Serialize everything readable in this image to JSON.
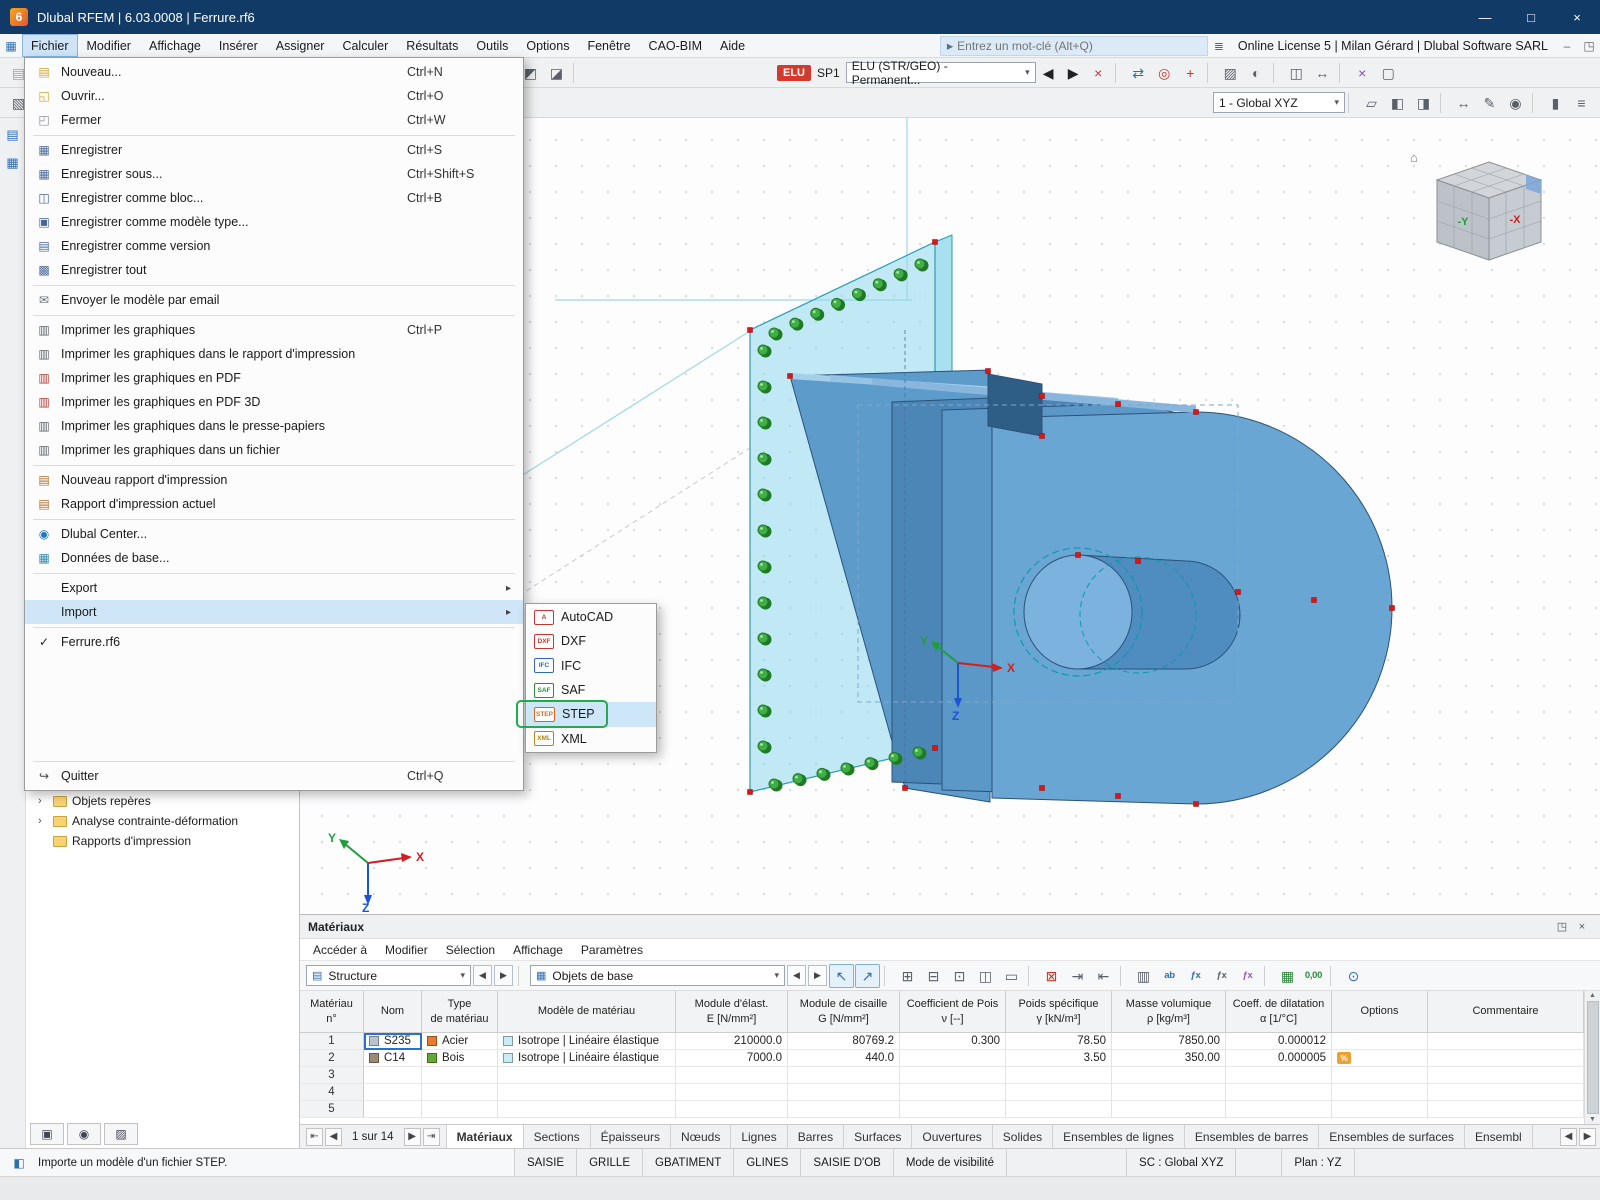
{
  "window": {
    "logo": "6",
    "title": "Dlubal RFEM | 6.03.0008 | Ferrure.rf6",
    "minimize": "—",
    "maximize": "□",
    "close": "×"
  },
  "menubar": {
    "items": [
      {
        "n": "menu-fichier",
        "label": "Fichier",
        "cls": "open"
      },
      {
        "n": "menu-modifier",
        "label": "Modifier"
      },
      {
        "n": "menu-affichage",
        "label": "Affichage"
      },
      {
        "n": "menu-inserer",
        "label": "Insérer"
      },
      {
        "n": "menu-assigner",
        "label": "Assigner"
      },
      {
        "n": "menu-calculer",
        "label": "Calculer"
      },
      {
        "n": "menu-resultats",
        "label": "Résultats"
      },
      {
        "n": "menu-outils",
        "label": "Outils"
      },
      {
        "n": "menu-options",
        "label": "Options"
      },
      {
        "n": "menu-fenetre",
        "label": "Fenêtre"
      },
      {
        "n": "menu-cao-bim",
        "label": "CAO-BIM"
      },
      {
        "n": "menu-aide",
        "label": "Aide"
      }
    ],
    "search_chevron": "▸",
    "search_placeholder": "Entrez un mot-clé (Alt+Q)",
    "license_icon": "≣",
    "license": "Online License 5 | Milan Gérard | Dlubal Software SARL"
  },
  "toolbar1": {
    "pre": [
      {
        "n": "new-file-icon",
        "c": "▤",
        "col": "#d1a33c"
      },
      {
        "n": "open-file-icon",
        "c": "◱",
        "col": "#d1a33c"
      },
      {
        "n": "save-file-icon",
        "c": "▦",
        "col": "#46679c"
      },
      {
        "n": "toolbar-separator",
        "cls": "sep"
      },
      {
        "n": "print-graphics-icon",
        "c": "▥",
        "col": "#5a6069"
      },
      {
        "n": "toolbar-separator",
        "cls": "sep"
      },
      {
        "n": "undo-icon",
        "c": "↶",
        "col": "#2e6db4"
      },
      {
        "n": "redo-icon",
        "c": "↷",
        "col": "#2e6db4"
      },
      {
        "n": "toolbar-separator",
        "cls": "sep"
      },
      {
        "n": "tables-icon",
        "c": "⊞",
        "col": "#5a6069"
      },
      {
        "n": "toolbar-separator",
        "cls": "sep"
      },
      {
        "n": "selection-polygon-icon",
        "c": "◇",
        "col": "#8a5cc9"
      },
      {
        "n": "selection-special-icon",
        "c": "◆",
        "col": "#c2579c"
      },
      {
        "n": "zoom-all-icon",
        "c": "⊙",
        "col": "#2e6db4"
      },
      {
        "n": "zoom-window-icon",
        "c": "⊡",
        "col": "#2e6db4"
      },
      {
        "n": "zoom-in-icon",
        "c": "⊕",
        "col": "#2e6db4"
      },
      {
        "n": "zoom-out-icon",
        "c": "⊖",
        "col": "#2e6db4"
      },
      {
        "n": "previous-view-icon",
        "c": "↺",
        "col": "#3aa06a"
      },
      {
        "n": "next-view-icon",
        "c": "↻",
        "col": "#3aa06a"
      },
      {
        "n": "toolbar-separator",
        "cls": "sep"
      },
      {
        "n": "view-isometric-icon",
        "c": "◧",
        "col": "#5a6069"
      },
      {
        "n": "view-in-x-icon",
        "c": "◨",
        "col": "#5a6069"
      },
      {
        "n": "view-in-y-icon",
        "c": "◩",
        "col": "#5a6069"
      },
      {
        "n": "view-in-z-icon",
        "c": "◪",
        "col": "#5a6069"
      },
      {
        "n": "toolbar-separator",
        "cls": "sep"
      }
    ],
    "badge": "ELU",
    "sp1": "SP1",
    "combo": "ELU (STR/GEO) - Permanent...",
    "prev": "◀",
    "next": "▶",
    "post": [
      {
        "n": "cancel-calculation-icon",
        "c": "×",
        "col": "#c0392b"
      },
      {
        "n": "toolbar-separator",
        "cls": "sep"
      },
      {
        "n": "sync-icon",
        "c": "⇄",
        "col": "#2e6db4"
      },
      {
        "n": "snap-target-icon",
        "c": "◎",
        "col": "#c0392b"
      },
      {
        "n": "coordinate-system-icon",
        "c": "+",
        "col": "#c0392b"
      },
      {
        "n": "toolbar-separator",
        "cls": "sep"
      },
      {
        "n": "display-properties-icon",
        "c": "▨",
        "col": "#5a6069"
      },
      {
        "n": "rendering-mode-icon",
        "c": "◐",
        "col": "#5a6069"
      },
      {
        "n": "toolbar-separator",
        "cls": "sep"
      },
      {
        "n": "clipping-plane-icon",
        "c": "◫",
        "col": "#5a6069"
      },
      {
        "n": "measure-icon",
        "c": "↔",
        "col": "#5a6069"
      },
      {
        "n": "toolbar-separator",
        "cls": "sep"
      },
      {
        "n": "delete-results-icon",
        "c": "×",
        "col": "#8a4bc9"
      },
      {
        "n": "visual-objects-icon",
        "c": "▢",
        "col": "#5a6069"
      }
    ]
  },
  "toolbar2": {
    "pre": [
      {
        "n": "new-objects-icon",
        "c": "▧",
        "col": "#5a6069"
      },
      {
        "n": "new-objects-dropdown-icon",
        "c": "▾",
        "col": "#5a6069",
        "cls": "narrow"
      },
      {
        "n": "toolbar-separator",
        "cls": "sep"
      },
      {
        "n": "insert-node-icon",
        "c": "•",
        "col": "#c0392b"
      },
      {
        "n": "insert-line-icon",
        "c": "╱",
        "col": "#2e6db4"
      },
      {
        "n": "insert-arc-icon",
        "c": "◠",
        "col": "#2e6db4"
      },
      {
        "n": "insert-surface-icon",
        "c": "▱",
        "col": "#3aa06a"
      },
      {
        "n": "insert-solid-icon",
        "c": "▣",
        "col": "#3aa06a"
      },
      {
        "n": "toolbar-separator",
        "cls": "sep"
      },
      {
        "n": "snap-grid-icon",
        "c": "⊞",
        "col": "#5a6069"
      },
      {
        "n": "object-snap-icon",
        "c": "⊡",
        "col": "#5a6069"
      },
      {
        "n": "guidelines-icon",
        "c": "≣",
        "col": "#5a6069"
      },
      {
        "n": "toolbar-separator",
        "cls": "sep"
      }
    ],
    "combo": "1 - Global XYZ",
    "post": [
      {
        "n": "toolbar-separator",
        "cls": "sep"
      },
      {
        "n": "work-plane-icon",
        "c": "▱",
        "col": "#5a6069"
      },
      {
        "n": "plane-xy-icon",
        "c": "◧",
        "col": "#5a6069"
      },
      {
        "n": "plane-yz-icon",
        "c": "◨",
        "col": "#5a6069"
      },
      {
        "n": "toolbar-separator",
        "cls": "sep"
      },
      {
        "n": "dimension-icon",
        "c": "↔",
        "col": "#5a6069"
      },
      {
        "n": "comment-icon",
        "c": "✎",
        "col": "#5a6069"
      },
      {
        "n": "visibility-mode-icon",
        "c": "◉",
        "col": "#5a6069"
      },
      {
        "n": "toolbar-separator",
        "cls": "sep"
      },
      {
        "n": "panel-toggle-icon",
        "c": "▮",
        "col": "#5a6069"
      },
      {
        "n": "configuration-icon",
        "c": "≡",
        "col": "#5a6069"
      }
    ]
  },
  "file_menu": {
    "items": [
      {
        "label": "Nouveau...",
        "shortcut": "Ctrl+N",
        "icon": "new-file-icon",
        "ic": "▤",
        "col": "#d1a33c"
      },
      {
        "label": "Ouvrir...",
        "shortcut": "Ctrl+O",
        "icon": "open-file-icon",
        "ic": "◱",
        "col": "#d1a33c"
      },
      {
        "label": "Fermer",
        "shortcut": "Ctrl+W",
        "icon": "close-file-icon",
        "ic": "◰",
        "col": "#8a8f96"
      },
      {
        "label": "Enregistrer",
        "shortcut": "Ctrl+S",
        "icon": "save-icon",
        "ic": "▦",
        "col": "#46679c",
        "cls": "sep-above"
      },
      {
        "label": "Enregistrer sous...",
        "shortcut": "Ctrl+Shift+S",
        "icon": "save-as-icon",
        "ic": "▦",
        "col": "#46679c"
      },
      {
        "label": "Enregistrer comme bloc...",
        "shortcut": "Ctrl+B",
        "icon": "save-as-block-icon",
        "ic": "◫",
        "col": "#46679c"
      },
      {
        "label": "Enregistrer comme modèle type...",
        "icon": "save-as-template-icon",
        "ic": "▣",
        "col": "#46679c"
      },
      {
        "label": "Enregistrer comme version",
        "icon": "save-as-version-icon",
        "ic": "▤",
        "col": "#46679c"
      },
      {
        "label": "Enregistrer tout",
        "icon": "save-all-icon",
        "ic": "▩",
        "col": "#46679c"
      },
      {
        "label": "Envoyer le modèle par email",
        "icon": "send-email-icon",
        "ic": "✉",
        "col": "#6a6f76",
        "cls": "sep-above"
      },
      {
        "label": "Imprimer les graphiques",
        "shortcut": "Ctrl+P",
        "icon": "print-icon",
        "ic": "▥",
        "col": "#5a6069",
        "cls": "sep-above"
      },
      {
        "label": "Imprimer les graphiques dans le rapport d'impression",
        "icon": "print-to-report-icon",
        "ic": "▥",
        "col": "#5a6069"
      },
      {
        "label": "Imprimer les graphiques en PDF",
        "icon": "print-pdf-icon",
        "ic": "▥",
        "col": "#c0392b"
      },
      {
        "label": "Imprimer les graphiques en PDF 3D",
        "icon": "print-pdf-3d-icon",
        "ic": "▥",
        "col": "#c0392b"
      },
      {
        "label": "Imprimer les graphiques dans le presse-papiers",
        "icon": "print-clipboard-icon",
        "ic": "▥",
        "col": "#5a6069"
      },
      {
        "label": "Imprimer les graphiques dans un fichier",
        "icon": "print-to-file-icon",
        "ic": "▥",
        "col": "#5a6069"
      },
      {
        "label": "Nouveau rapport d'impression",
        "icon": "new-report-icon",
        "ic": "▤",
        "col": "#b06a2a",
        "cls": "sep-above"
      },
      {
        "label": "Rapport d'impression actuel",
        "icon": "current-report-icon",
        "ic": "▤",
        "col": "#b06a2a"
      },
      {
        "label": "Dlubal Center...",
        "icon": "dlubal-center-icon",
        "ic": "◉",
        "col": "#1d79c4",
        "cls": "sep-above"
      },
      {
        "label": "Données de base...",
        "icon": "base-data-icon",
        "ic": "▦",
        "col": "#2e86ab"
      },
      {
        "label": "Export",
        "sub": "▸",
        "cls": "sep-above"
      },
      {
        "label": "Import",
        "sub": "▸",
        "cls": "highlight"
      },
      {
        "label": "Ferrure.rf6",
        "icon": "check-icon",
        "ic": "✓",
        "col": "#222",
        "cls": "sep-above"
      },
      {
        "label": "Quitter",
        "shortcut": "Ctrl+Q",
        "icon": "quit-icon",
        "ic": "↪",
        "col": "#444",
        "cls": "sep-above push-bottom"
      }
    ]
  },
  "import_submenu": {
    "items": [
      {
        "label": "AutoCAD",
        "icon": "autocad-icon",
        "badge": "A",
        "col": "#c0392b"
      },
      {
        "label": "DXF",
        "icon": "dxf-icon",
        "badge": "DXF",
        "col": "#c0392b"
      },
      {
        "label": "IFC",
        "icon": "ifc-icon",
        "badge": "IFC",
        "col": "#2b6cb5"
      },
      {
        "label": "SAF",
        "icon": "saf-icon",
        "badge": "SAF",
        "col": "#2e8b3a"
      },
      {
        "label": "STEP",
        "icon": "step-icon",
        "badge": "STEP",
        "col": "#d2691e",
        "cls": "selected"
      },
      {
        "label": "XML",
        "icon": "xml-icon",
        "badge": "XML",
        "col": "#b8860b"
      }
    ]
  },
  "dock": {
    "icons": [
      {
        "n": "navigator-dock-icon",
        "c": "▤"
      },
      {
        "n": "tables-dock-icon",
        "c": "▦"
      }
    ]
  },
  "navigator": {
    "items": [
      {
        "n": "nav-item-objets-reperes",
        "chev": "›",
        "label": "Objets repères"
      },
      {
        "n": "nav-item-analyse-contrainte",
        "chev": "›",
        "label": "Analyse contrainte-déformation"
      },
      {
        "n": "nav-item-rapports-impression",
        "chev": "",
        "label": "Rapports d'impression"
      }
    ],
    "bottom": [
      {
        "n": "display-manager-button",
        "c": "▣"
      },
      {
        "n": "visibility-eye-button",
        "c": "◉"
      },
      {
        "n": "camera-button",
        "c": "▨"
      }
    ]
  },
  "viewport": {
    "axes": {
      "x": "X",
      "y": "Y",
      "z": "Z"
    },
    "cube": {
      "front": "-Y",
      "side": "-X",
      "home": "⌂"
    }
  },
  "materials": {
    "title": "Matériaux",
    "float_icon": "◳",
    "close_icon": "×",
    "menu": [
      {
        "n": "mat-menu-acceder",
        "label": "Accéder à"
      },
      {
        "n": "mat-menu-modifier",
        "label": "Modifier"
      },
      {
        "n": "mat-menu-selection",
        "label": "Sélection"
      },
      {
        "n": "mat-menu-affichage",
        "label": "Affichage"
      },
      {
        "n": "mat-menu-parametres",
        "label": "Paramètres"
      }
    ],
    "combo1": "Structure",
    "combo2": "Objets de base",
    "nav_prev": "◀",
    "nav_next": "▶",
    "icons": [
      {
        "n": "select-related-objects-icon",
        "c": "↖",
        "col": "#2e6db4",
        "cls": "boxed"
      },
      {
        "n": "select-in-graphic-icon",
        "c": "↗",
        "col": "#2e6db4",
        "cls": "boxed"
      },
      {
        "n": "toolbar-separator",
        "cls": "sep"
      },
      {
        "n": "add-row-icon",
        "c": "⊞",
        "col": "#5a6069"
      },
      {
        "n": "delete-row-icon",
        "c": "⊟",
        "col": "#5a6069"
      },
      {
        "n": "insert-row-icon",
        "c": "⊡",
        "col": "#5a6069"
      },
      {
        "n": "copy-row-icon",
        "c": "◫",
        "col": "#5a6069"
      },
      {
        "n": "empty-rows-icon",
        "c": "▭",
        "col": "#5a6069"
      },
      {
        "n": "toolbar-separator",
        "cls": "sep"
      },
      {
        "n": "filter-icon",
        "c": "⊠",
        "col": "#c0392b"
      },
      {
        "n": "import-table-icon",
        "c": "⇥",
        "col": "#5a6069"
      },
      {
        "n": "export-table-icon",
        "c": "⇤",
        "col": "#5a6069"
      },
      {
        "n": "toolbar-separator",
        "cls": "sep"
      },
      {
        "n": "view-mode-icon",
        "c": "▥",
        "col": "#5a6069"
      },
      {
        "n": "spell-check-icon",
        "c": "ab",
        "col": "#2e6db4",
        "cls": "txt"
      },
      {
        "n": "formula-icon",
        "c": "ƒx",
        "col": "#2e6db4",
        "cls": "txt"
      },
      {
        "n": "formula-bar-icon",
        "c": "ƒx",
        "col": "#5a6069",
        "cls": "txt"
      },
      {
        "n": "formula-edit-icon",
        "c": "ƒx",
        "col": "#9a52c7",
        "cls": "txt"
      },
      {
        "n": "toolbar-separator",
        "cls": "sep"
      },
      {
        "n": "table-columns-icon",
        "c": "▦",
        "col": "#2e8b3a"
      },
      {
        "n": "decimal-places-icon",
        "c": "0,00",
        "col": "#2e8b3a",
        "cls": "txt"
      },
      {
        "n": "toolbar-separator",
        "cls": "sep"
      },
      {
        "n": "search-in-table-icon",
        "c": "⊙",
        "col": "#2e6db4"
      }
    ],
    "columns": [
      {
        "l1": "Matériau",
        "l2": "n°"
      },
      {
        "l1": "Nom",
        "l2": ""
      },
      {
        "l1": "Type",
        "l2": "de matériau"
      },
      {
        "l1": "Modèle de matériau",
        "l2": ""
      },
      {
        "l1": "Module d'élast.",
        "l2": "E [N/mm²]"
      },
      {
        "l1": "Module de cisaille",
        "l2": "G [N/mm²]"
      },
      {
        "l1": "Coefficient de Pois",
        "l2": "ν [--]"
      },
      {
        "l1": "Poids spécifique",
        "l2": "γ [kN/m³]"
      },
      {
        "l1": "Masse volumique",
        "l2": "ρ [kg/m³]"
      },
      {
        "l1": "Coeff. de dilatation",
        "l2": "α [1/°C]"
      },
      {
        "l1": "Options",
        "l2": ""
      },
      {
        "l1": "Commentaire",
        "l2": ""
      }
    ],
    "rows": [
      {
        "num": "1",
        "nom": "S235",
        "nom_sw": "#b9c4cf",
        "nom_cls": "sel",
        "type": "Acier",
        "type_sw": "#e87a2a",
        "model": "Isotrope | Linéaire élastique",
        "model_sw": "#c8ecf7",
        "e": "210000.0",
        "g": "80769.2",
        "nu": "0.300",
        "gamma": "78.50",
        "rho": "7850.00",
        "alpha": "0.000012",
        "opt": "",
        "comment": ""
      },
      {
        "num": "2",
        "nom": "C14",
        "nom_sw": "#9c8a74",
        "type": "Bois",
        "type_sw": "#62a832",
        "model": "Isotrope | Linéaire élastique",
        "model_sw": "#c8ecf7",
        "e": "7000.0",
        "g": "440.0",
        "nu": "",
        "gamma": "3.50",
        "rho": "350.00",
        "alpha": "0.000005",
        "opt": "%",
        "opt_sw": "#f0a030",
        "comment": ""
      },
      {
        "num": "3"
      },
      {
        "num": "4"
      },
      {
        "num": "5"
      }
    ],
    "pager": {
      "first": "⇤",
      "prev": "◀",
      "label": "1 sur 14",
      "next": "▶",
      "last": "⇥"
    },
    "tabs": [
      {
        "n": "tab-materiaux",
        "label": "Matériaux",
        "cls": "active"
      },
      {
        "n": "tab-sections",
        "label": "Sections"
      },
      {
        "n": "tab-epaisseurs",
        "label": "Épaisseurs"
      },
      {
        "n": "tab-noeuds",
        "label": "Nœuds"
      },
      {
        "n": "tab-lignes",
        "label": "Lignes"
      },
      {
        "n": "tab-barres",
        "label": "Barres"
      },
      {
        "n": "tab-surfaces",
        "label": "Surfaces"
      },
      {
        "n": "tab-ouvertures",
        "label": "Ouvertures"
      },
      {
        "n": "tab-solides",
        "label": "Solides"
      },
      {
        "n": "tab-ensembles-lignes",
        "label": "Ensembles de lignes"
      },
      {
        "n": "tab-ensembles-barres",
        "label": "Ensembles de barres"
      },
      {
        "n": "tab-ensembles-surfaces",
        "label": "Ensembles de surfaces"
      },
      {
        "n": "tab-ensembles-solides",
        "label": "Ensembl"
      }
    ],
    "tab_scroll_left": "◀",
    "tab_scroll_right": "▶"
  },
  "statusbar": {
    "message": "Importe un modèle d'un fichier STEP.",
    "toggles": [
      {
        "n": "status-saisie",
        "label": "SAISIE"
      },
      {
        "n": "status-grille",
        "label": "GRILLE"
      },
      {
        "n": "status-gbatiment",
        "label": "GBATIMENT"
      },
      {
        "n": "status-glines",
        "label": "GLINES"
      },
      {
        "n": "status-saisie-dob",
        "label": "SAISIE D'OB"
      },
      {
        "n": "status-mode-visibilite",
        "label": "Mode de visibilité"
      }
    ],
    "cs": "SC : Global XYZ",
    "plan": "Plan : YZ"
  }
}
